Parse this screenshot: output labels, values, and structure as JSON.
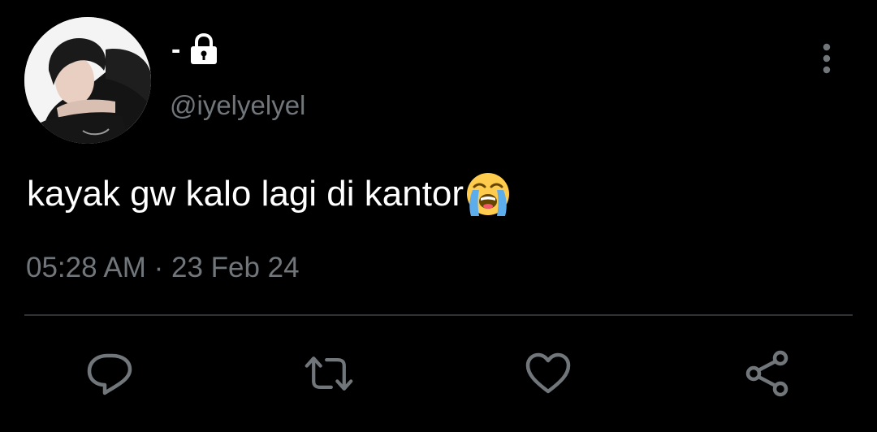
{
  "author": {
    "display_name": "-",
    "handle": "@iyelyelyel",
    "avatar_icon": "profile-photo",
    "protected_icon": "lock-icon"
  },
  "tweet": {
    "text": "kayak gw kalo lagi di kantor",
    "emoji": "loudly-crying-face-emoji"
  },
  "meta": {
    "timestamp": "05:28 AM · 23 Feb 24"
  },
  "actions": [
    {
      "name": "reply",
      "icon": "reply-icon"
    },
    {
      "name": "retweet",
      "icon": "retweet-icon"
    },
    {
      "name": "like",
      "icon": "heart-icon"
    },
    {
      "name": "share",
      "icon": "share-icon"
    }
  ],
  "colors": {
    "background": "#000000",
    "primary_text": "#ffffff",
    "secondary_text": "#71767b",
    "divider": "#2f3336",
    "icon": "#71767b"
  }
}
